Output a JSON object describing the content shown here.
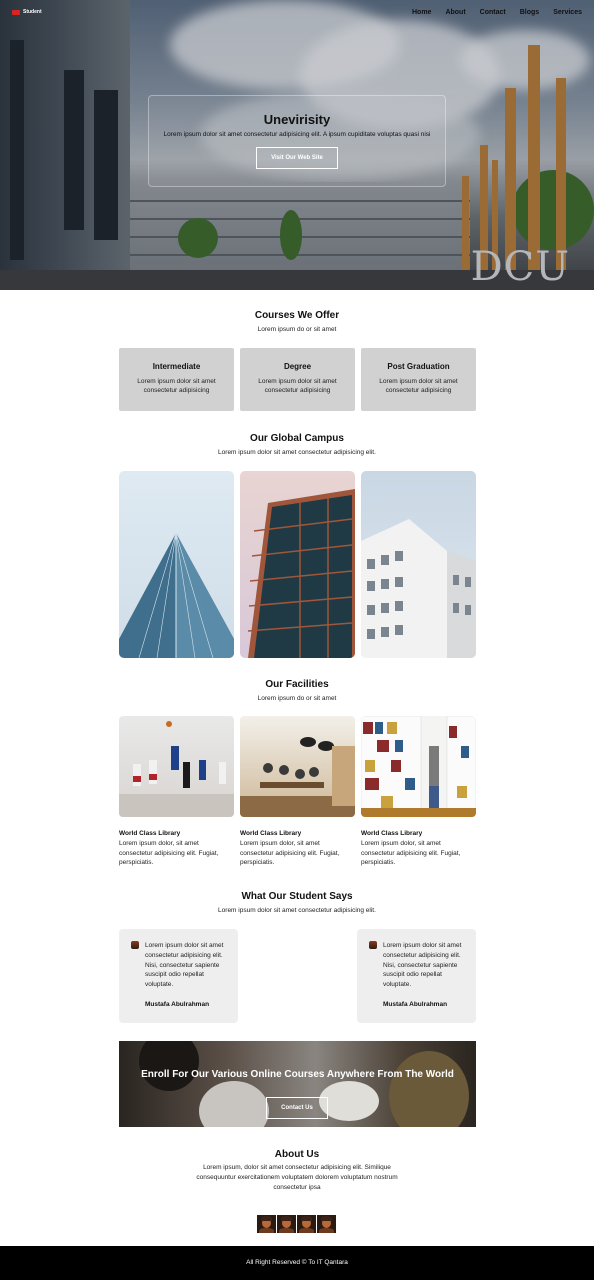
{
  "nav": {
    "logo_text": "Student",
    "links": [
      "Home",
      "About",
      "Contact",
      "Blogs",
      "Services"
    ]
  },
  "hero": {
    "title": "Unevirisity",
    "subtitle": "Lorem ipsum dolor sit amet consectetur adipisicing elit. A ipsum cupiditate voluptas quasi nisi",
    "button": "Visit Our Web Site",
    "sign_text": "DCU"
  },
  "courses": {
    "title": "Courses We Offer",
    "subtitle": "Lorem ipsum do or sit amet",
    "items": [
      {
        "title": "Intermediate",
        "desc": "Lorem ipsum dolor sit amet consectetur adipisicing"
      },
      {
        "title": "Degree",
        "desc": "Lorem ipsum dolor sit amet consectetur adipisicing"
      },
      {
        "title": "Post Graduation",
        "desc": "Lorem ipsum dolor sit amet consectetur adipisicing"
      }
    ]
  },
  "campus": {
    "title": "Our Global Campus",
    "subtitle": "Lorem ipsum dolor sit amet consectetur adipisicing elit."
  },
  "facilities": {
    "title": "Our Facilities",
    "subtitle": "Lorem ipsum do or sit amet",
    "items": [
      {
        "title": "World Class Library",
        "desc": "Lorem ipsum dolor, sit amet consectetur adipisicing elit. Fugiat, perspiciatis."
      },
      {
        "title": "World Class Library",
        "desc": "Lorem ipsum dolor, sit amet consectetur adipisicing elit. Fugiat, perspiciatis."
      },
      {
        "title": "World Class Library",
        "desc": "Lorem ipsum dolor, sit amet consectetur adipisicing elit. Fugiat, perspiciatis."
      }
    ]
  },
  "testimonials": {
    "title": "What Our Student Says",
    "subtitle": "Lorem ipsum dolor sit amet consectetur adipisicing elit.",
    "items": [
      {
        "quote": "Lorem ipsum dolor sit amet consectetur adipisicing elit. Nisi, consectetur sapiente suscipit odio repellat voluptate.",
        "name": "Mustafa Abulrahman"
      },
      {
        "quote": "Lorem ipsum dolor sit amet consectetur adipisicing elit. Nisi, consectetur sapiente suscipit odio repellat voluptate.",
        "name": "Mustafa Abulrahman"
      }
    ]
  },
  "enroll": {
    "title": "Enroll For Our Various Online Courses Anywhere From The World",
    "button": "Contact Us"
  },
  "about": {
    "title": "About Us",
    "text": "Lorem ipsum, dolor sit amet consectetur adipisicing elit. Similique consequuntur exercitationem voluptatem dolorem voluptatum nostrum consectetur ipsa"
  },
  "footer": {
    "text": "All Right Reserved © To IT Qantara"
  },
  "colors": {
    "accent": "#dd2222",
    "card_bg": "#d1d1d1",
    "testimonial_bg": "#eeeeee",
    "footer_bg": "#000000"
  }
}
